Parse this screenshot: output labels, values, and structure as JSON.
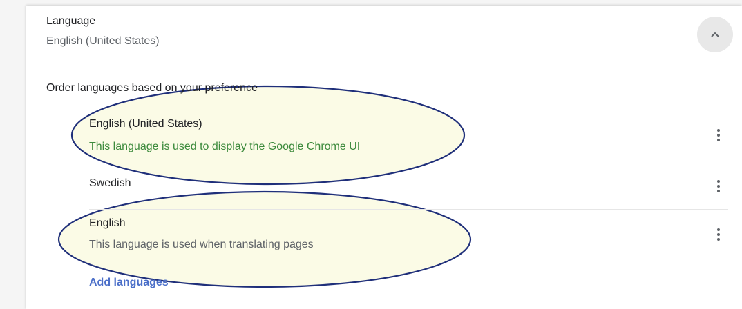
{
  "section": {
    "title": "Language",
    "current_value": "English (United States)"
  },
  "order_heading": "Order languages based on your preference",
  "languages": [
    {
      "name": "English (United States)",
      "description": "This language is used to display the Google Chrome UI"
    },
    {
      "name": "Swedish",
      "description": ""
    },
    {
      "name": "English",
      "description": "This language is used when translating pages"
    }
  ],
  "add_languages_label": "Add languages",
  "colors": {
    "link": "#4b6fc9",
    "ui_note": "#3c8a3c",
    "annotation_stroke": "#1f2f7a",
    "annotation_fill": "#fbfbe6"
  },
  "icons": {
    "collapse": "chevron-up-icon",
    "row_menu": "more-vert-icon"
  }
}
